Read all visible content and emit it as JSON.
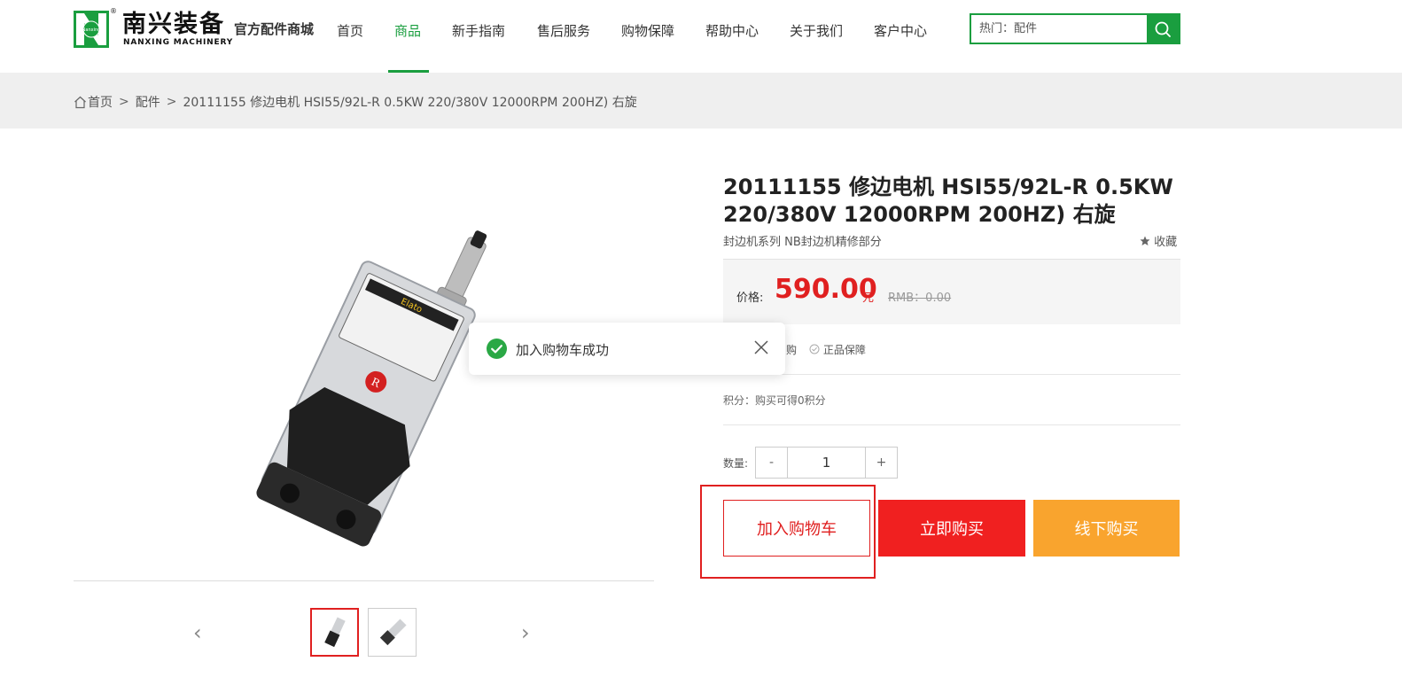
{
  "brand": {
    "name_cn": "南兴装备",
    "name_en": "NANXING MACHINERY",
    "mark_text": "Nanxing",
    "registered": "®",
    "tagline": "官方配件商城",
    "color": "#1a9e3f"
  },
  "nav": {
    "items": [
      {
        "label": "首页"
      },
      {
        "label": "商品",
        "active": true
      },
      {
        "label": "新手指南"
      },
      {
        "label": "售后服务"
      },
      {
        "label": "购物保障"
      },
      {
        "label": "帮助中心"
      },
      {
        "label": "关于我们"
      },
      {
        "label": "客户中心"
      }
    ]
  },
  "search": {
    "placeholder": "热门：配件",
    "icon": "search-icon"
  },
  "breadcrumb": {
    "home": "首页",
    "sep": ">",
    "category": "配件",
    "current": "20111155 修边电机 HSI55/92L-R 0.5KW 220/380V 12000RPM 200HZ) 右旋"
  },
  "product": {
    "title": "20111155 修边电机 HSI55/92L-R 0.5KW 220/380V 12000RPM 200HZ) 右旋",
    "subtitle": "封边机系列 NB封边机精修部分",
    "favorite": "收藏",
    "price_label": "价格:",
    "price": "590.00",
    "price_unit": "元",
    "old_price": "RMB：0.00",
    "guarantee_partial": "购",
    "guarantee": "正品保障",
    "points": "积分：购买可得0积分",
    "qty_label": "数量:",
    "qty_minus": "-",
    "qty_value": "1",
    "qty_plus": "+",
    "btn_cart": "加入购物车",
    "btn_buy": "立即购买",
    "btn_offline": "线下购买",
    "label_text": "Elato",
    "logo_text": "R",
    "accent_red": "#e02020",
    "accent_orange": "#f9a42e"
  },
  "toast": {
    "message": "加入购物车成功",
    "icon": "check-circle-icon",
    "close_icon": "close-icon"
  },
  "gallery": {
    "prev_icon": "‹",
    "next_icon": "›"
  }
}
